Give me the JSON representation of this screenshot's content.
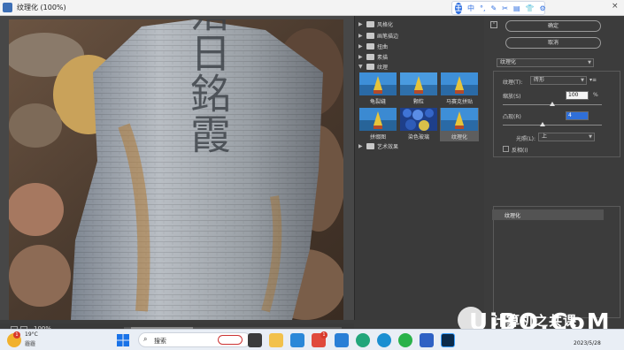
{
  "window": {
    "title": "纹理化 (100%)",
    "close_glyph": "×"
  },
  "ime": {
    "logo": "王",
    "items": [
      "中",
      "°,",
      "✎",
      "✂",
      "▤",
      "👕",
      "⚙"
    ]
  },
  "canvas": {
    "stone_text": "落日銘霞",
    "zoom_label": "100%",
    "status_hint": "1000 文字大 1000 鼠标按钮"
  },
  "gallery": {
    "categories": [
      {
        "label": "风格化",
        "expanded": false
      },
      {
        "label": "画笔描边",
        "expanded": false
      },
      {
        "label": "扭曲",
        "expanded": false
      },
      {
        "label": "素描",
        "expanded": false
      },
      {
        "label": "纹理",
        "expanded": true
      },
      {
        "label": "艺术效果",
        "expanded": false
      }
    ],
    "thumbnails": [
      {
        "label": "龟裂缝",
        "selected": false
      },
      {
        "label": "颗粒",
        "selected": false
      },
      {
        "label": "马赛克拼贴",
        "selected": false
      },
      {
        "label": "拼缀图",
        "selected": false
      },
      {
        "label": "染色玻璃",
        "selected": false
      },
      {
        "label": "纹理化",
        "selected": true
      }
    ]
  },
  "panel": {
    "ok_label": "确定",
    "cancel_label": "取消",
    "filter_select": "纹理化",
    "texture_label": "纹理(T):",
    "texture_value": "砖形",
    "texture_menu": "▾≡",
    "scaling_label": "缩放(S)",
    "scaling_value": "100",
    "scaling_unit": "%",
    "scaling_level": 0.5,
    "relief_label": "凸现(R)",
    "relief_value": "4",
    "relief_level": 0.4,
    "light_label": "光照(L):",
    "light_value": "上",
    "invert_label": "反相(I)",
    "invert_checked": false,
    "layer_name": "纹理化"
  },
  "taskbar": {
    "temperature": "19°C",
    "weather": "霾霾",
    "weather_badge": "1",
    "search_placeholder": "搜索",
    "app_badge": "1",
    "date": "2023/5/28"
  },
  "watermark": {
    "chinese": "计算机之共课",
    "latin": "UiBQ.CoM"
  }
}
